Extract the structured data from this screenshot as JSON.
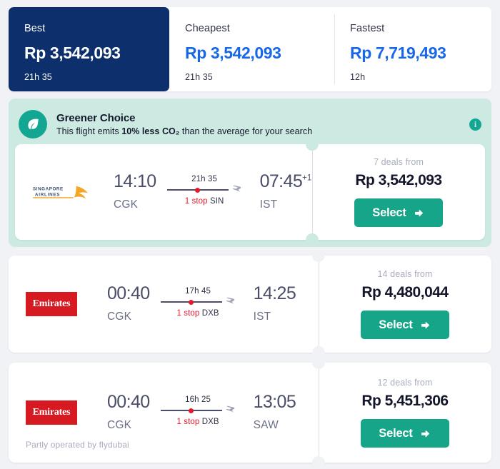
{
  "tabs": [
    {
      "label": "Best",
      "price": "Rp 3,542,093",
      "duration": "21h 35",
      "active": true
    },
    {
      "label": "Cheapest",
      "price": "Rp 3,542,093",
      "duration": "21h 35",
      "active": false
    },
    {
      "label": "Fastest",
      "price": "Rp 7,719,493",
      "duration": "12h",
      "active": false
    }
  ],
  "greener": {
    "icon": "leaf-icon",
    "title": "Greener Choice",
    "sub_prefix": "This flight emits ",
    "sub_bold": "10% less CO₂",
    "sub_suffix": " than the average for your search",
    "info_icon": "info-icon",
    "info_glyph": "i",
    "bg_color": "#cdeae2",
    "badge_color": "#12a693"
  },
  "flights": [
    {
      "airline": "Singapore Airlines",
      "airline_logo": "singapore-airlines-logo",
      "logo_line1": "SINGAPORE",
      "logo_line2": "AIRLINES",
      "depart_time": "14:10",
      "depart_code": "CGK",
      "duration": "21h 35",
      "stops": "1 stop",
      "stop_airport": "SIN",
      "arrive_time": "07:45",
      "arrive_day_offset": "+1",
      "arrive_code": "IST",
      "deals": "7 deals from",
      "price": "Rp 3,542,093",
      "select_label": "Select",
      "operated_by": ""
    },
    {
      "airline": "Emirates",
      "airline_logo": "emirates-logo",
      "logo_text": "Emirates",
      "depart_time": "00:40",
      "depart_code": "CGK",
      "duration": "17h 45",
      "stops": "1 stop",
      "stop_airport": "DXB",
      "arrive_time": "14:25",
      "arrive_day_offset": "",
      "arrive_code": "IST",
      "deals": "14 deals from",
      "price": "Rp 4,480,044",
      "select_label": "Select",
      "operated_by": ""
    },
    {
      "airline": "Emirates",
      "airline_logo": "emirates-logo",
      "logo_text": "Emirates",
      "depart_time": "00:40",
      "depart_code": "CGK",
      "duration": "16h 25",
      "stops": "1 stop",
      "stop_airport": "DXB",
      "arrive_time": "13:05",
      "arrive_day_offset": "",
      "arrive_code": "SAW",
      "deals": "12 deals from",
      "price": "Rp 5,451,306",
      "select_label": "Select",
      "operated_by": "Partly operated by flydubai"
    }
  ],
  "colors": {
    "page_bg": "#f1f2f6",
    "tab_active_bg": "#0d2f6b",
    "link_blue": "#1767e8",
    "select_green": "#17a589",
    "stop_red": "#e8192c",
    "emirates_red": "#d71921"
  }
}
